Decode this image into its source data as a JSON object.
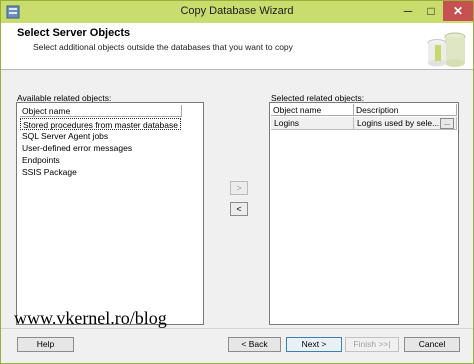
{
  "window": {
    "title": "Copy Database Wizard",
    "minimize_glyph": "─",
    "maximize_glyph": "□",
    "close_glyph": "✕"
  },
  "header": {
    "title": "Select Server Objects",
    "subtitle": "Select additional objects outside the databases that you want to copy"
  },
  "available": {
    "label": "Available related objects:",
    "column": "Object name",
    "items": [
      "Stored procedures from master database",
      "SQL Server Agent jobs",
      "User-defined error messages",
      "Endpoints",
      "SSIS Package"
    ]
  },
  "move_buttons": {
    "add": ">",
    "remove": "<"
  },
  "selected": {
    "label": "Selected related objects:",
    "columns": [
      "Object name",
      "Description"
    ],
    "rows": [
      {
        "name": "Logins",
        "description": "Logins used by sele...",
        "button": "..."
      }
    ]
  },
  "footer": {
    "help": "Help",
    "back": "< Back",
    "next": "Next >",
    "finish": "Finish >>|",
    "cancel": "Cancel"
  },
  "watermark": "www.vkernel.ro/blog"
}
